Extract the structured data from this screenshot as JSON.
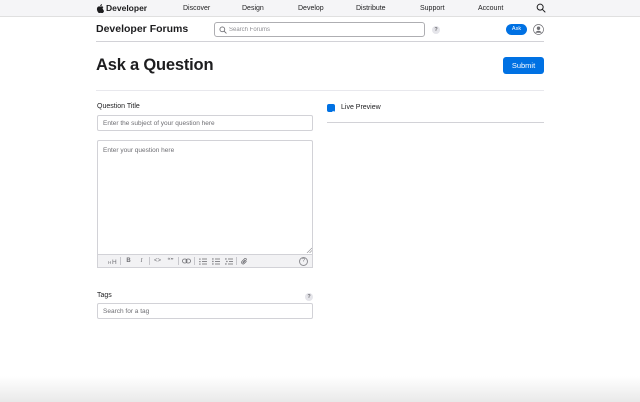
{
  "globalnav": {
    "brand": "Developer",
    "links": [
      "Discover",
      "Design",
      "Develop",
      "Distribute",
      "Support",
      "Account"
    ],
    "icons": {
      "logo": "apple-logo-icon",
      "search": "search-icon"
    }
  },
  "subnav": {
    "title": "Developer Forums",
    "search_placeholder": "Search Forums",
    "help": "?",
    "ask_label": "Ask",
    "avatar_icon": "user-avatar-icon"
  },
  "page": {
    "title": "Ask a Question",
    "submit_label": "Submit"
  },
  "form": {
    "question_title_label": "Question Title",
    "question_title_placeholder": "Enter the subject of your question here",
    "question_body_placeholder": "Enter your question here",
    "toolbar": {
      "heading": "H",
      "bold": "B",
      "italic": "I",
      "code": "<>",
      "quote": "“”",
      "help": "?"
    },
    "tags_label": "Tags",
    "tags_help": "?",
    "tags_placeholder": "Search for a tag"
  },
  "preview": {
    "live_preview_label": "Live Preview",
    "live_preview_checked": true
  },
  "colors": {
    "accent": "#0071e3",
    "nav_bg": "#f5f5f7",
    "border": "#d2d2d7"
  }
}
